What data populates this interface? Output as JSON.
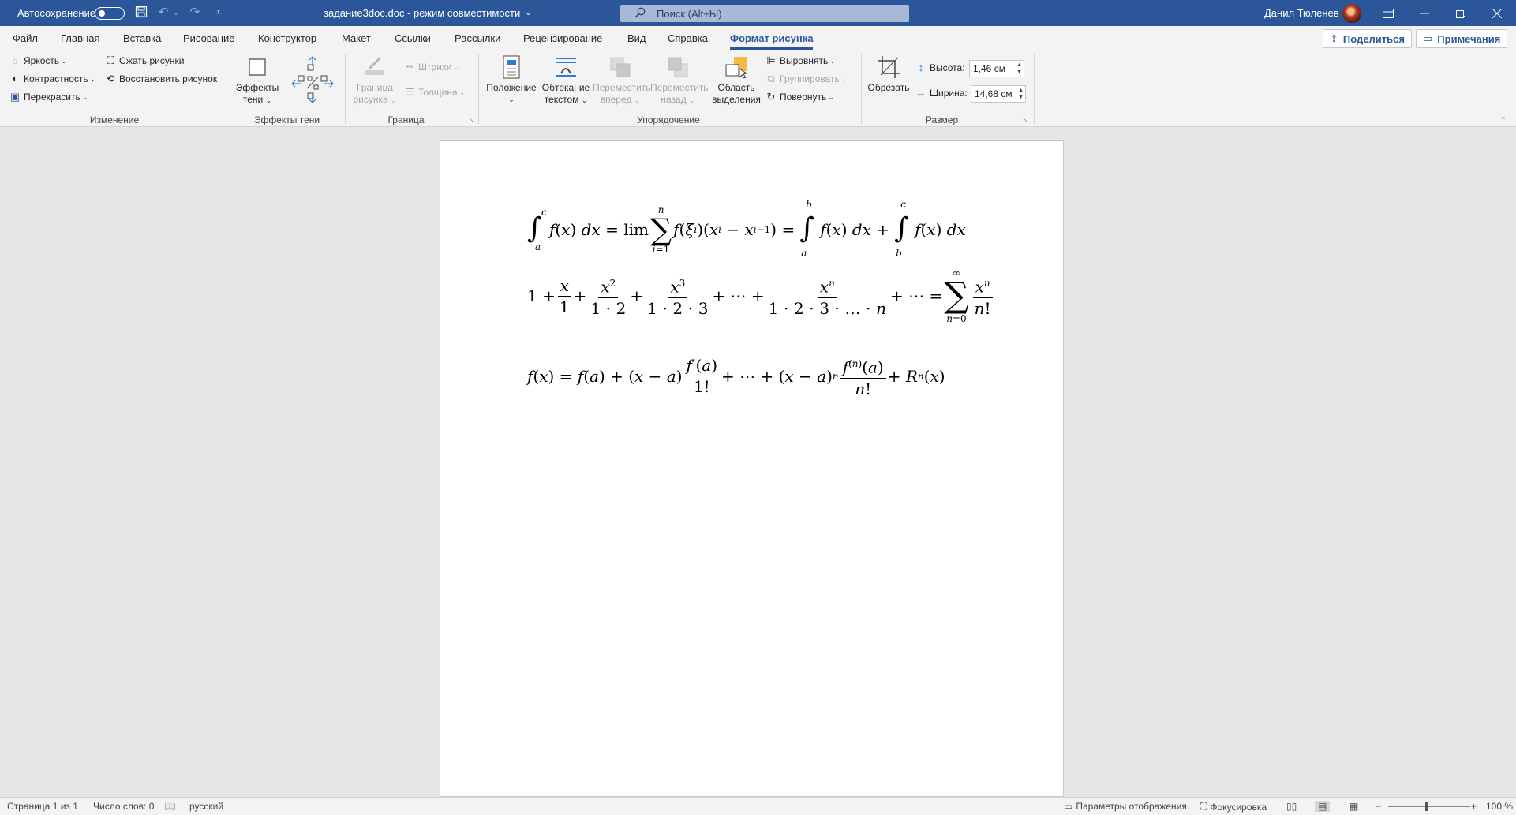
{
  "titlebar": {
    "autosave_label": "Автосохранение",
    "doc_title": "задание3doc.doc  -  режим совместимости",
    "doc_title_caret": "⌄",
    "search_placeholder": "Поиск (Alt+Ы)",
    "user_name": "Данил Тюленев"
  },
  "menu": {
    "tabs": [
      "Файл",
      "Главная",
      "Вставка",
      "Рисование",
      "Конструктор",
      "Макет",
      "Ссылки",
      "Рассылки",
      "Рецензирование",
      "Вид",
      "Справка",
      "Формат рисунка"
    ],
    "active_tab": "Формат рисунка",
    "share_label": "Поделиться",
    "comments_label": "Примечания"
  },
  "ribbon": {
    "izmenenie": {
      "brightness": "Яркость",
      "contrast": "Контрастность",
      "recolor": "Перекрасить",
      "compress": "Сжать рисунки",
      "restore": "Восстановить рисунок",
      "label": "Изменение"
    },
    "shadow": {
      "effects_line1": "Эффекты",
      "effects_line2": "тени",
      "label": "Эффекты тени"
    },
    "border": {
      "border_line1": "Граница",
      "border_line2": "рисунка",
      "dashes": "Штрихи",
      "weight": "Толщина",
      "label": "Граница"
    },
    "arrange": {
      "position": "Положение",
      "wrap_line1": "Обтекание",
      "wrap_line2": "текстом",
      "forward_line1": "Переместить",
      "forward_line2": "вперед",
      "backward_line1": "Переместить",
      "backward_line2": "назад",
      "selection_line1": "Область",
      "selection_line2": "выделения",
      "align": "Выровнять",
      "group": "Группировать",
      "rotate": "Повернуть",
      "label": "Упорядочение"
    },
    "size": {
      "crop": "Обрезать",
      "height_label": "Высота:",
      "height_value": "1,46 см",
      "width_label": "Ширина:",
      "width_value": "14,68 см",
      "label": "Размер"
    }
  },
  "statusbar": {
    "page": "Страница 1 из 1",
    "words": "Число слов: 0",
    "language": "русский",
    "display_settings": "Параметры отображения",
    "focus": "Фокусировка",
    "zoom": "100 %"
  },
  "colors": {
    "accent": "#2b579a",
    "ribbon_bg": "#f3f3f3",
    "canvas_bg": "#e6e6e6",
    "page_bg": "#ffffff"
  }
}
